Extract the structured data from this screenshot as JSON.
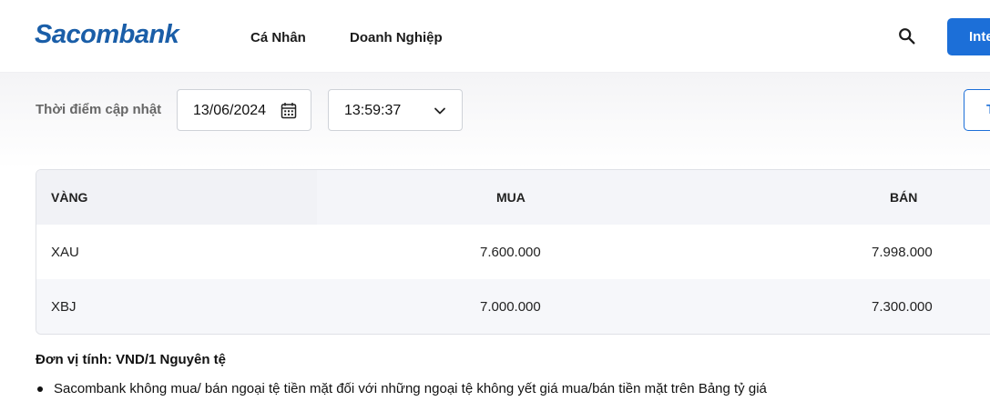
{
  "header": {
    "logo": "Sacombank",
    "nav": [
      "Cá Nhân",
      "Doanh Nghiệp"
    ],
    "button_label": "Inte",
    "search_icon": "search-icon"
  },
  "filter": {
    "label": "Thời điểm cập nhật",
    "date_value": "13/06/2024",
    "time_value": "13:59:37",
    "right_button_label": "T"
  },
  "table": {
    "columns": [
      "VÀNG",
      "MUA",
      "BÁN"
    ],
    "rows": [
      {
        "name": "XAU",
        "buy": "7.600.000",
        "sell": "7.998.000"
      },
      {
        "name": "XBJ",
        "buy": "7.000.000",
        "sell": "7.300.000"
      }
    ]
  },
  "notes": {
    "unit": "Đơn vị tính: VND/1 Nguyên tệ",
    "bullets": [
      "Sacombank không mua/ bán ngoại tệ tiền mặt đối với những ngoại tệ không yết giá mua/bán tiền mặt trên Bảng tỷ giá"
    ]
  },
  "colors": {
    "brand": "#1a5ea8",
    "accent": "#1c6fd8"
  }
}
